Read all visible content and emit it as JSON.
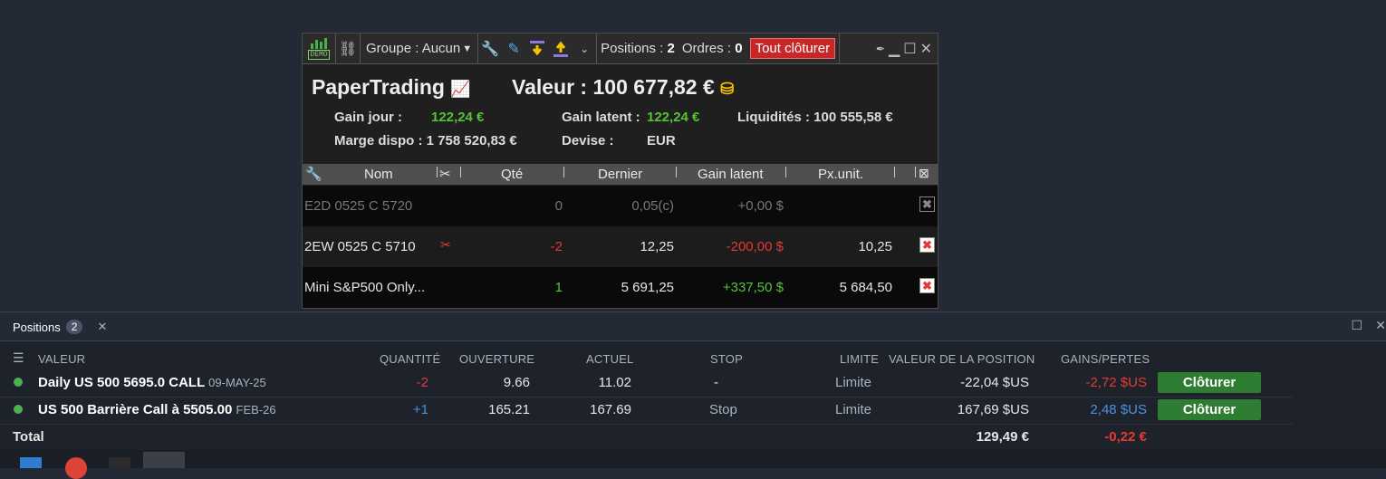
{
  "toolbar": {
    "demo_label": "DEMO",
    "group_label": "Groupe : Aucun",
    "positions_label": "Positions : ",
    "positions_count": "2",
    "orders_label": "Ordres : ",
    "orders_count": "0",
    "close_all_label": "Tout clôturer"
  },
  "account": {
    "name": "PaperTrading",
    "value_label": "Valeur : 100 677,82 €",
    "gain_jour_label": "Gain jour :",
    "gain_jour_value": "122,24 €",
    "gain_latent_label": "Gain latent :",
    "gain_latent_value": "122,24 €",
    "liquidites_label": "Liquidités : 100 555,58 €",
    "marge_label": "Marge dispo : 1 758 520,83 €",
    "devise_label": "Devise :",
    "devise_value": "EUR"
  },
  "table": {
    "headers": {
      "nom": "Nom",
      "qte": "Qté",
      "dernier": "Dernier",
      "gain": "Gain latent",
      "px": "Px.unit."
    },
    "rows": [
      {
        "nom": "E2D 0525 C 5720",
        "qte": "0",
        "dernier": "0,05(c)",
        "gain": "+0,00 $",
        "px": ""
      },
      {
        "nom": "2EW 0525 C 5710",
        "qte": "-2",
        "dernier": "12,25",
        "gain": "-200,00 $",
        "px": "10,25"
      },
      {
        "nom": "Mini S&P500 Only...",
        "qte": "1",
        "dernier": "5 691,25",
        "gain": "+337,50 $",
        "px": "5 684,50"
      }
    ]
  },
  "panel": {
    "tab_label": "Positions",
    "tab_count": "2",
    "headers": {
      "valeur": "VALEUR",
      "quantite": "QUANTITÉ",
      "ouverture": "OUVERTURE",
      "actuel": "ACTUEL",
      "stop": "STOP",
      "limite": "LIMITE",
      "valeur_position": "VALEUR DE LA POSITION",
      "gains": "GAINS/PERTES"
    },
    "rows": [
      {
        "name": "Daily US 500 5695.0 CALL",
        "sub": "09-MAY-25",
        "qty": "-2",
        "open": "9.66",
        "current": "11.02",
        "stop": "-",
        "limit": "Limite",
        "pos_value": "-22,04 $US",
        "pnl": "-2,72 $US",
        "btn": "Clôturer"
      },
      {
        "name": "US 500 Barrière Call à 5505.00",
        "sub": "FEB-26",
        "qty": "+1",
        "open": "165.21",
        "current": "167.69",
        "stop": "Stop",
        "limit": "Limite",
        "pos_value": "167,69 $US",
        "pnl": "2,48 $US",
        "btn": "Clôturer"
      }
    ],
    "total_label": "Total",
    "total_value": "129,49 €",
    "total_pnl": "-0,22 €"
  },
  "colors": {
    "green": "#55c23a",
    "red": "#e53935",
    "blue": "#4a90e2",
    "button_green": "#2e7d32",
    "close_all_red": "#c62828"
  }
}
